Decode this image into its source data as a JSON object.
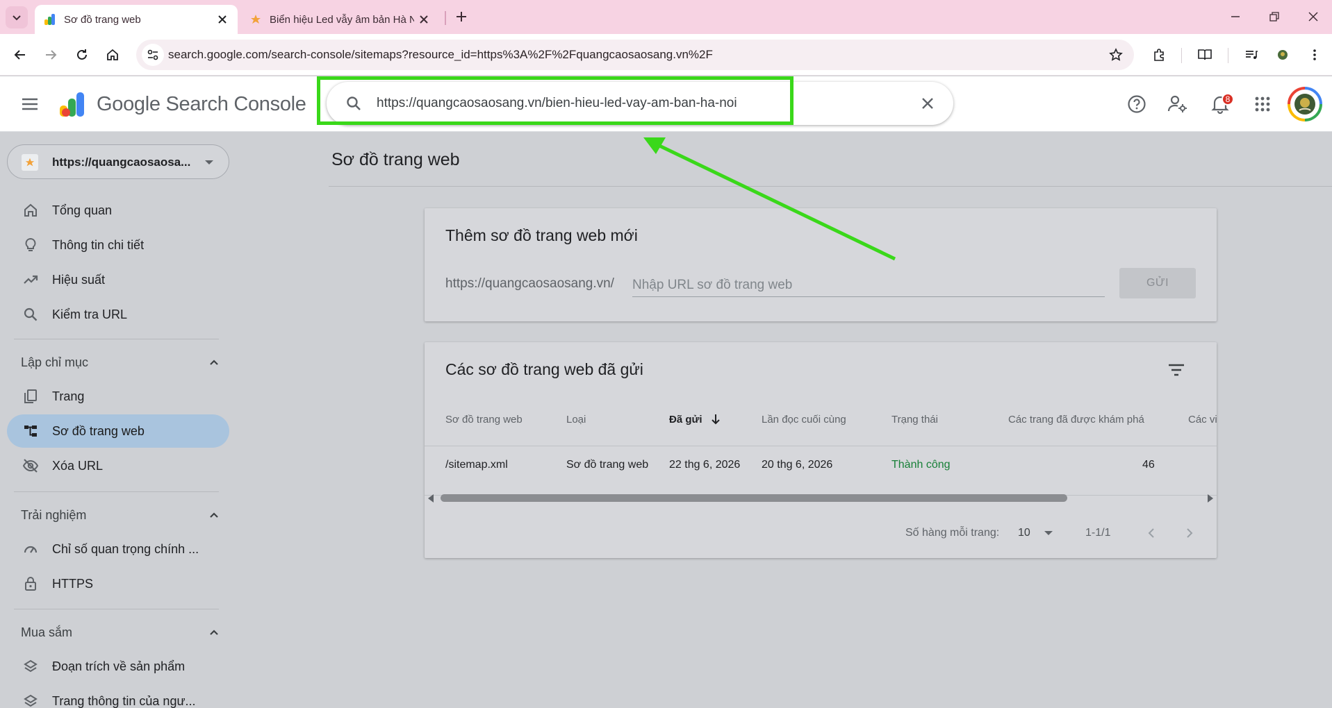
{
  "browser": {
    "tabs": [
      {
        "title": "Sơ đồ trang web",
        "active": true
      },
      {
        "title": "Biển hiệu Led vẫy âm bản Hà Nội",
        "active": false
      }
    ],
    "address_bar": "search.google.com/search-console/sitemaps?resource_id=https%3A%2F%2Fquangcaosaosang.vn%2F"
  },
  "app": {
    "title": "Google Search Console",
    "search_value": "https://quangcaosaosang.vn/bien-hieu-led-vay-am-ban-ha-noi",
    "notification_count": "8"
  },
  "sidebar": {
    "property": "https://quangcaosaosa...",
    "top_items": [
      {
        "label": "Tổng quan",
        "icon": "home-icon"
      },
      {
        "label": "Thông tin chi tiết",
        "icon": "lightbulb-icon"
      },
      {
        "label": "Hiệu suất",
        "icon": "trending-up-icon"
      },
      {
        "label": "Kiểm tra URL",
        "icon": "search-icon"
      }
    ],
    "sections": [
      {
        "label": "Lập chỉ mục",
        "items": [
          {
            "label": "Trang",
            "icon": "pages-icon"
          },
          {
            "label": "Sơ đồ trang web",
            "icon": "sitemap-icon",
            "active": true
          },
          {
            "label": "Xóa URL",
            "icon": "visibility-off-icon"
          }
        ]
      },
      {
        "label": "Trải nghiệm",
        "items": [
          {
            "label": "Chỉ số quan trọng chính ...",
            "icon": "speed-icon"
          },
          {
            "label": "HTTPS",
            "icon": "lock-icon"
          }
        ]
      },
      {
        "label": "Mua sắm",
        "items": [
          {
            "label": "Đoạn trích về sản phẩm",
            "icon": "layers-icon"
          },
          {
            "label": "Trang thông tin của ngư...",
            "icon": "layers-icon"
          }
        ]
      }
    ]
  },
  "main": {
    "page_title": "Sơ đồ trang web",
    "add_card": {
      "title": "Thêm sơ đồ trang web mới",
      "prefix": "https://quangcaosaosang.vn/",
      "placeholder": "Nhập URL sơ đồ trang web",
      "submit_label": "GỬI"
    },
    "submitted_card": {
      "title": "Các sơ đồ trang web đã gửi",
      "columns": [
        "Sơ đồ trang web",
        "Loại",
        "Đã gửi",
        "Lần đọc cuối cùng",
        "Trạng thái",
        "Các trang đã được khám phá",
        "Các vi"
      ],
      "rows": [
        {
          "sitemap": "/sitemap.xml",
          "type": "Sơ đồ trang web",
          "submitted": "22 thg 6, 2026",
          "last_read": "20 thg 6, 2026",
          "status": "Thành công",
          "pages": "46"
        }
      ],
      "rows_per_page_label": "Số hàng mỗi trang:",
      "rows_per_page": "10",
      "range": "1-1/1"
    }
  },
  "colors": {
    "highlight": "#3ad81a",
    "status_ok": "#188038",
    "active_nav": "#a9c4de"
  }
}
